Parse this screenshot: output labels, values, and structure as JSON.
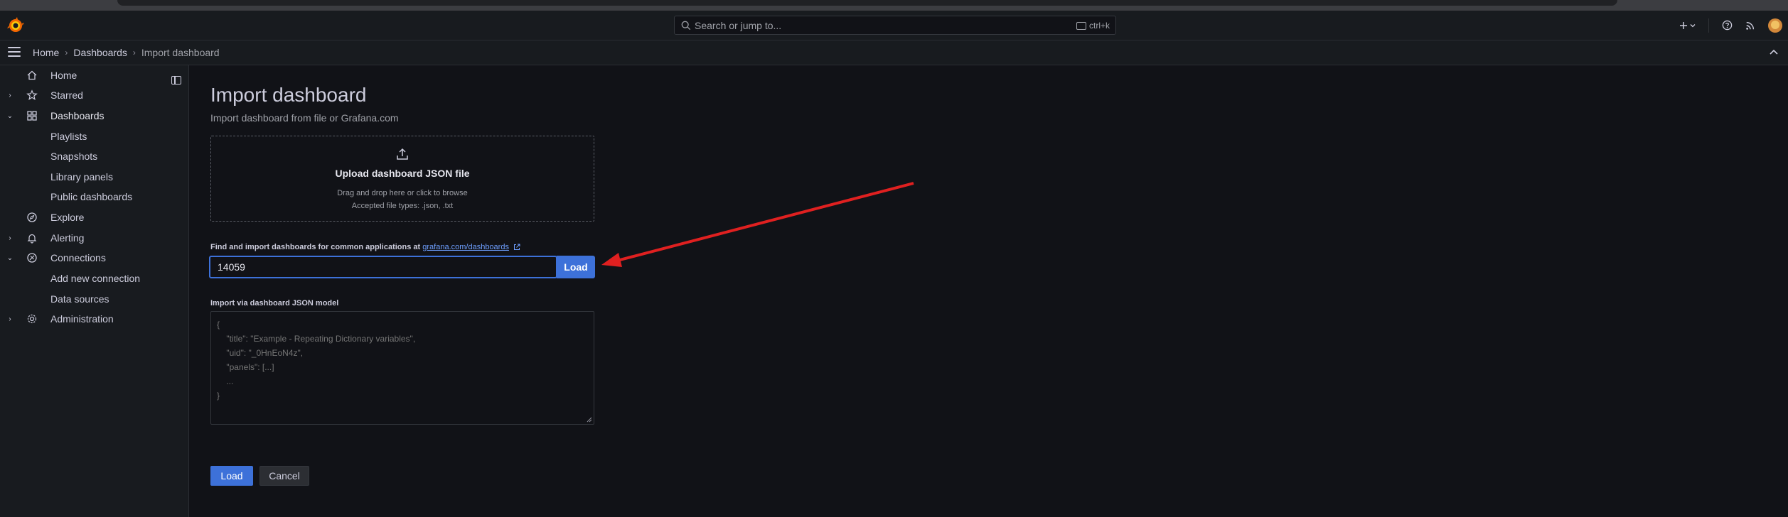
{
  "topbar": {
    "search_placeholder": "Search or jump to...",
    "search_shortcut": "ctrl+k",
    "icons": [
      "grafana-logo-icon",
      "search-icon",
      "plus-icon",
      "chevron-down-icon",
      "help-icon",
      "rss-icon",
      "avatar"
    ]
  },
  "breadcrumb": {
    "home": "Home",
    "dashboards": "Dashboards",
    "current": "Import dashboard"
  },
  "sidebar": {
    "items": [
      {
        "label": "Home",
        "icon": "home-icon"
      },
      {
        "label": "Starred",
        "icon": "star-icon"
      },
      {
        "label": "Dashboards",
        "icon": "dashboards-icon"
      },
      {
        "label": "Playlists"
      },
      {
        "label": "Snapshots"
      },
      {
        "label": "Library panels"
      },
      {
        "label": "Public dashboards"
      },
      {
        "label": "Explore",
        "icon": "compass-icon"
      },
      {
        "label": "Alerting",
        "icon": "bell-icon"
      },
      {
        "label": "Connections",
        "icon": "connections-icon"
      },
      {
        "label": "Add new connection"
      },
      {
        "label": "Data sources"
      },
      {
        "label": "Administration",
        "icon": "cog-icon"
      }
    ]
  },
  "main": {
    "title": "Import dashboard",
    "subtitle": "Import dashboard from file or Grafana.com",
    "upload": {
      "title": "Upload dashboard JSON file",
      "hint": "Drag and drop here or click to browse",
      "types": "Accepted file types: .json, .txt"
    },
    "find_label": "Find and import dashboards for common applications at",
    "find_link": "grafana.com/dashboards",
    "id_value": "14059",
    "load_inline": "Load",
    "json_label": "Import via dashboard JSON model",
    "json_placeholder": "{\n    \"title\": \"Example - Repeating Dictionary variables\",\n    \"uid\": \"_0HnEoN4z\",\n    \"panels\": [...]\n    ...\n}",
    "load_button": "Load",
    "cancel_button": "Cancel"
  },
  "colors": {
    "primary": "#3d71d9",
    "annotation_arrow": "#e02020",
    "link": "#6e9fff",
    "background": "#111217",
    "panel": "#181b1f"
  }
}
